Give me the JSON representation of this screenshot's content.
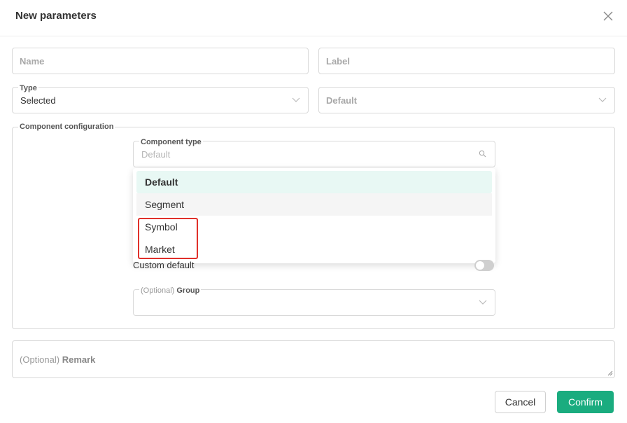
{
  "dialog": {
    "title": "New parameters"
  },
  "form": {
    "name": {
      "placeholder": "Name"
    },
    "label": {
      "placeholder": "Label"
    },
    "type": {
      "label": "Type",
      "value": "Selected"
    },
    "default": {
      "placeholder": "Default"
    },
    "component_configuration": {
      "title": "Component configuration",
      "component_type": {
        "label": "Component type",
        "placeholder": "Default"
      },
      "options": [
        "Default",
        "Segment",
        "Symbol",
        "Market"
      ],
      "selected_option": "Default",
      "custom_default": {
        "label": "Custom default",
        "enabled": false
      },
      "group": {
        "optional_prefix": "(Optional)",
        "label": "Group"
      }
    },
    "remark": {
      "optional_prefix": "(Optional)",
      "label": "Remark"
    }
  },
  "footer": {
    "cancel_label": "Cancel",
    "confirm_label": "Confirm"
  },
  "colors": {
    "accent": "#1aac7f",
    "selected_bg": "#e8f8f4",
    "highlight": "#e0302a"
  }
}
